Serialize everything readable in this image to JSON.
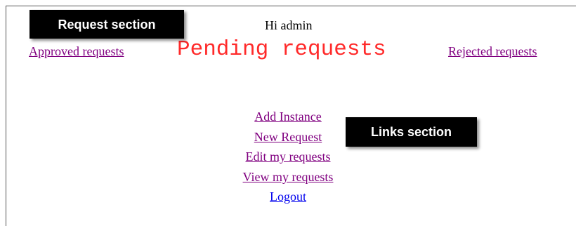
{
  "callouts": {
    "request_section": "Request section",
    "links_section": "Links section"
  },
  "header": {
    "greeting": "Hi admin"
  },
  "requests_nav": {
    "approved": "Approved requests",
    "pending": "Pending requests",
    "rejected": "Rejected requests"
  },
  "links": {
    "add_instance": "Add Instance",
    "new_request": "New Request",
    "edit_my_requests": "Edit my requests",
    "view_my_requests": "View my requests",
    "logout": "Logout"
  },
  "colors": {
    "visited_link": "#800080",
    "link": "#0000ee",
    "pending_title": "#ff2a2a",
    "callout_bg": "#000000"
  }
}
